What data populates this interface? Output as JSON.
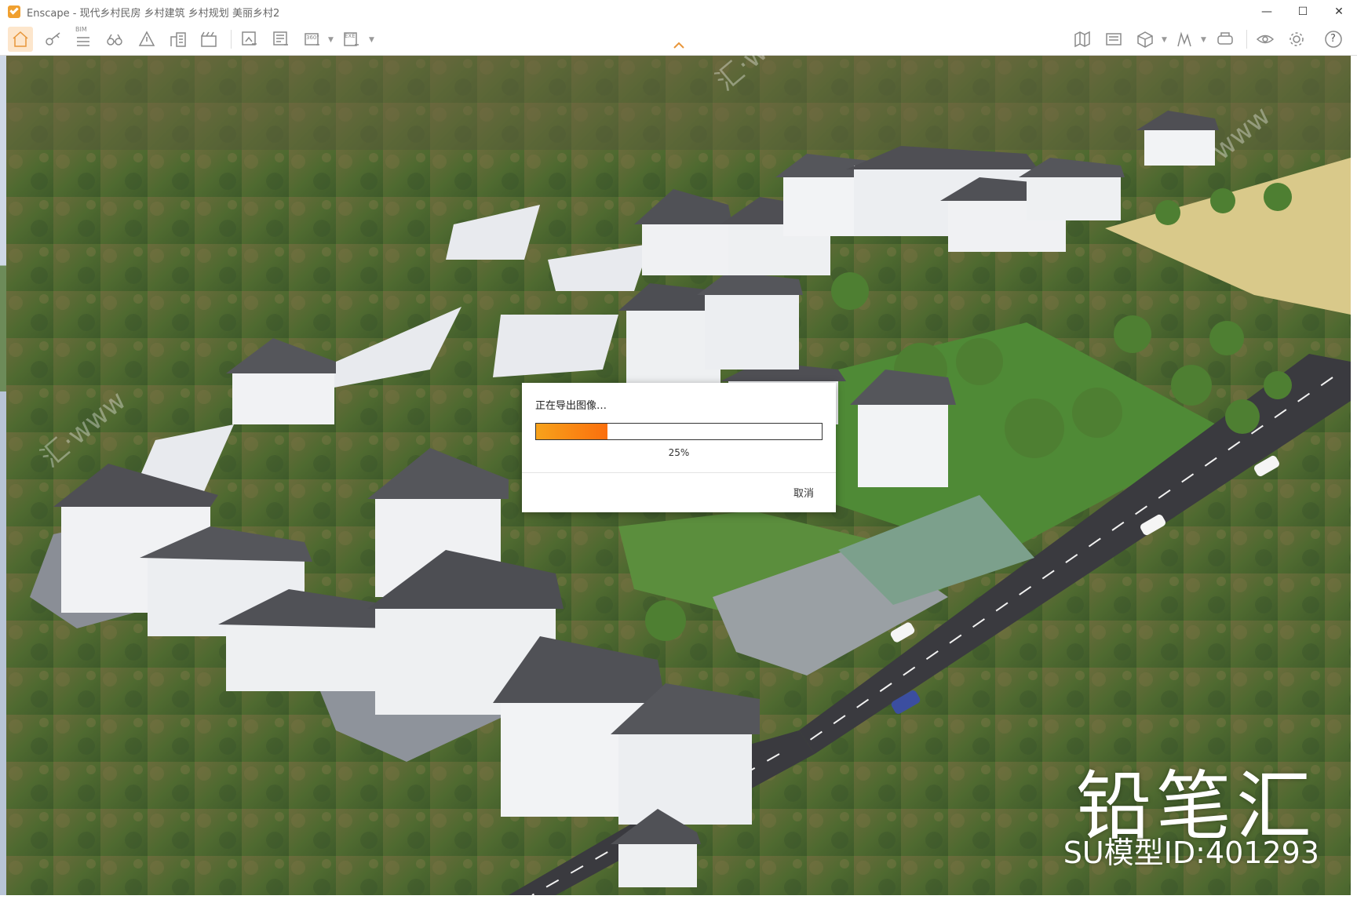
{
  "window": {
    "title": "Enscape - 现代乡村民房 乡村建筑 乡村规划 美丽乡村2",
    "minimize_symbol": "—",
    "maximize_symbol": "☐",
    "close_symbol": "✕"
  },
  "toolbar": {
    "left_icons": [
      "home-icon",
      "key-icon",
      "bim-icon",
      "binoculars-icon",
      "asset-library-icon",
      "buildings-icon",
      "video-icon"
    ],
    "export_icons": [
      "screenshot-export-icon",
      "batch-export-icon",
      "panorama-export-icon",
      "exe-export-icon"
    ],
    "right_icons": [
      "map-icon",
      "sun-icon",
      "cube-icon",
      "chart-icon",
      "vr-headset-icon",
      "eye-icon",
      "settings-icon",
      "help-icon"
    ],
    "bim_label": "BIM",
    "exe_label": "EXE",
    "pano_label": "360°",
    "help_label": "?",
    "accent_color": "#e8963a"
  },
  "dialog": {
    "title": "正在导出图像…",
    "progress": 0.25,
    "progress_label": "25%",
    "cancel_label": "取消"
  },
  "watermark": {
    "brand": "铅笔汇",
    "model_id": "SU模型ID:401293"
  }
}
